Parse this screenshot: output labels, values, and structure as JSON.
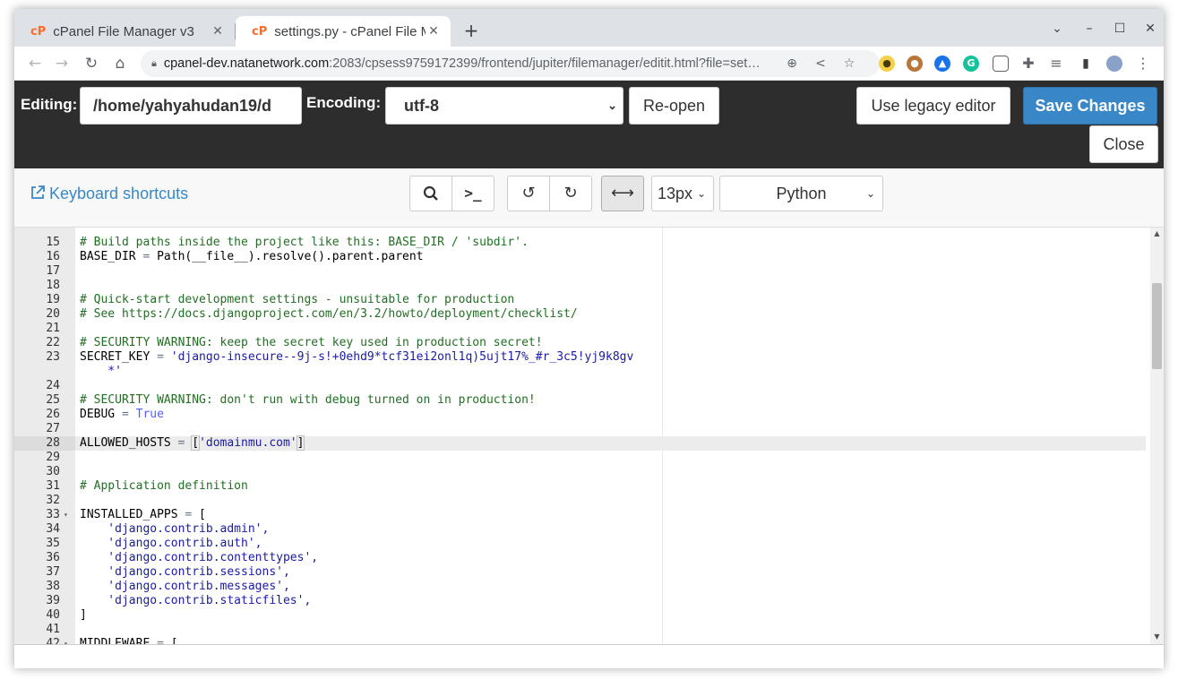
{
  "browser": {
    "tabs": [
      {
        "favicon": "cP",
        "title": "cPanel File Manager v3",
        "close": "✕"
      },
      {
        "favicon": "cP",
        "title": "settings.py - cPanel File M",
        "close": "✕"
      }
    ],
    "new_tab": "+",
    "window_controls": {
      "dropdown": "⌄",
      "minimize": "–",
      "maximize": "☐",
      "close": "✕"
    },
    "nav": {
      "back": "←",
      "forward": "→",
      "reload": "↻",
      "home": "⌂"
    },
    "url_host": "cpanel-dev.natanetwork.com",
    "url_path": ":2083/cpsess9759172399/frontend/jupiter/filemanager/editit.html?file=set…",
    "omni_icons": {
      "zoom": "⊕",
      "share": "<",
      "bookmark": "☆"
    },
    "extensions": [
      {
        "name": "bee-extension-icon",
        "glyph": "●",
        "color": "#d9a500"
      },
      {
        "name": "cookie-extension-icon",
        "glyph": "●",
        "color": "#a0522d"
      },
      {
        "name": "cloud-extension-icon",
        "glyph": "▲",
        "color": "#1a73e8"
      },
      {
        "name": "grammarly-extension-icon",
        "glyph": "G",
        "color": "#15c39a"
      },
      {
        "name": "chat-extension-icon",
        "glyph": "▢",
        "color": "#5f6368"
      },
      {
        "name": "puzzle-extension-icon",
        "glyph": "✚",
        "color": "#5f6368"
      },
      {
        "name": "media-control-icon",
        "glyph": "≡",
        "color": "#5f6368"
      },
      {
        "name": "sidepanel-icon",
        "glyph": "▮",
        "color": "#5f6368"
      },
      {
        "name": "profile-avatar",
        "glyph": "●",
        "color": "#8aa2c8"
      },
      {
        "name": "menu-icon",
        "glyph": "⋮",
        "color": "#5f6368"
      }
    ]
  },
  "header": {
    "editing_label": "Editing:",
    "path_value": "/home/yahyahudan19/d",
    "encoding_label": "Encoding:",
    "encoding_value": "utf-8",
    "reopen": "Re-open",
    "legacy": "Use legacy editor",
    "save": "Save Changes",
    "close": "Close"
  },
  "toolbar": {
    "keyboard_shortcuts": "Keyboard shortcuts",
    "font_size": "13px",
    "language": "Python",
    "icons": {
      "search": "⌕",
      "terminal": ">_",
      "undo": "↺",
      "redo": "↻",
      "wrap": "⟷"
    }
  },
  "editor": {
    "active_line": 28,
    "lines": [
      {
        "n": "15",
        "fold": "",
        "cls": "c-comment",
        "text": "# Build paths inside the project like this: BASE_DIR / 'subdir'."
      },
      {
        "n": "16",
        "fold": "",
        "cls": "",
        "text": "BASE_DIR = Path(__file__).resolve().parent.parent"
      },
      {
        "n": "17",
        "fold": "",
        "cls": "",
        "text": ""
      },
      {
        "n": "18",
        "fold": "",
        "cls": "",
        "text": ""
      },
      {
        "n": "19",
        "fold": "",
        "cls": "c-comment",
        "text": "# Quick-start development settings - unsuitable for production"
      },
      {
        "n": "20",
        "fold": "",
        "cls": "c-comment",
        "text": "# See https://docs.djangoproject.com/en/3.2/howto/deployment/checklist/"
      },
      {
        "n": "21",
        "fold": "",
        "cls": "",
        "text": ""
      },
      {
        "n": "22",
        "fold": "",
        "cls": "c-comment",
        "text": "# SECURITY WARNING: keep the secret key used in production secret!"
      },
      {
        "n": "23",
        "fold": "",
        "cls": "",
        "text": "SECRET_KEY = 'django-insecure--9j-s!+0ehd9*tcf31ei2onl1q)5ujt17%_#r_3c5!yj9k8gv"
      },
      {
        "n": "",
        "fold": "",
        "cls": "c-string",
        "text": "    *'"
      },
      {
        "n": "24",
        "fold": "",
        "cls": "",
        "text": ""
      },
      {
        "n": "25",
        "fold": "",
        "cls": "c-comment",
        "text": "# SECURITY WARNING: don't run with debug turned on in production!"
      },
      {
        "n": "26",
        "fold": "",
        "cls": "",
        "text": "DEBUG = True"
      },
      {
        "n": "27",
        "fold": "",
        "cls": "",
        "text": ""
      },
      {
        "n": "28",
        "fold": "",
        "cls": "",
        "text": "ALLOWED_HOSTS = ['domainmu.com']"
      },
      {
        "n": "29",
        "fold": "",
        "cls": "",
        "text": ""
      },
      {
        "n": "30",
        "fold": "",
        "cls": "",
        "text": ""
      },
      {
        "n": "31",
        "fold": "",
        "cls": "c-comment",
        "text": "# Application definition"
      },
      {
        "n": "32",
        "fold": "",
        "cls": "",
        "text": ""
      },
      {
        "n": "33",
        "fold": "▾",
        "cls": "",
        "text": "INSTALLED_APPS = ["
      },
      {
        "n": "34",
        "fold": "",
        "cls": "c-string",
        "text": "    'django.contrib.admin',"
      },
      {
        "n": "35",
        "fold": "",
        "cls": "c-string",
        "text": "    'django.contrib.auth',"
      },
      {
        "n": "36",
        "fold": "",
        "cls": "c-string",
        "text": "    'django.contrib.contenttypes',"
      },
      {
        "n": "37",
        "fold": "",
        "cls": "c-string",
        "text": "    'django.contrib.sessions',"
      },
      {
        "n": "38",
        "fold": "",
        "cls": "c-string",
        "text": "    'django.contrib.messages',"
      },
      {
        "n": "39",
        "fold": "",
        "cls": "c-string",
        "text": "    'django.contrib.staticfiles',"
      },
      {
        "n": "40",
        "fold": "",
        "cls": "",
        "text": "]"
      },
      {
        "n": "41",
        "fold": "",
        "cls": "",
        "text": ""
      },
      {
        "n": "42",
        "fold": "▾",
        "cls": "",
        "text": "MIDDLEWARE = ["
      }
    ]
  },
  "colors": {
    "header_bg": "#2d2d2d",
    "save_button": "#3a87c8",
    "link": "#3a87c8",
    "comment": "#236e24",
    "string": "#1a1aa6",
    "constant": "#585cf6"
  }
}
